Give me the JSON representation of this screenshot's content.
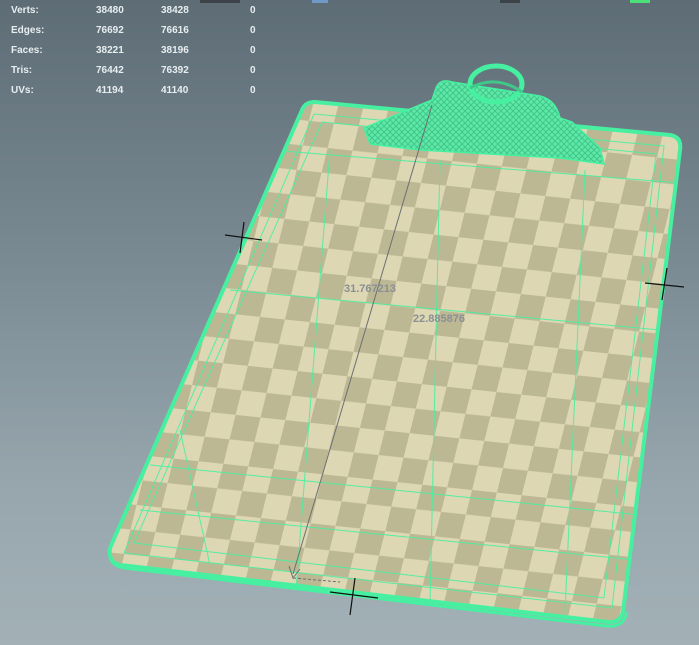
{
  "hud": {
    "rows": [
      {
        "label": "Verts:",
        "a": "38480",
        "b": "38428",
        "c": "0"
      },
      {
        "label": "Edges:",
        "a": "76692",
        "b": "76616",
        "c": "0"
      },
      {
        "label": "Faces:",
        "a": "38221",
        "b": "38196",
        "c": "0"
      },
      {
        "label": "Tris:",
        "a": "76442",
        "b": "76392",
        "c": "0"
      },
      {
        "label": "UVs:",
        "a": "41194",
        "b": "41140",
        "c": "0"
      }
    ]
  },
  "measurements": {
    "distance_1": "31.767213",
    "distance_2": "22.885876"
  },
  "colors": {
    "selection_wire": "#46f0a0",
    "checker_light": "#ddd7b4",
    "checker_dark": "#b9b491",
    "viewport_top": "#5d6c75",
    "viewport_bottom": "#a3b1b7"
  },
  "icons": {
    "manipulator": "plus-cross-icon"
  }
}
